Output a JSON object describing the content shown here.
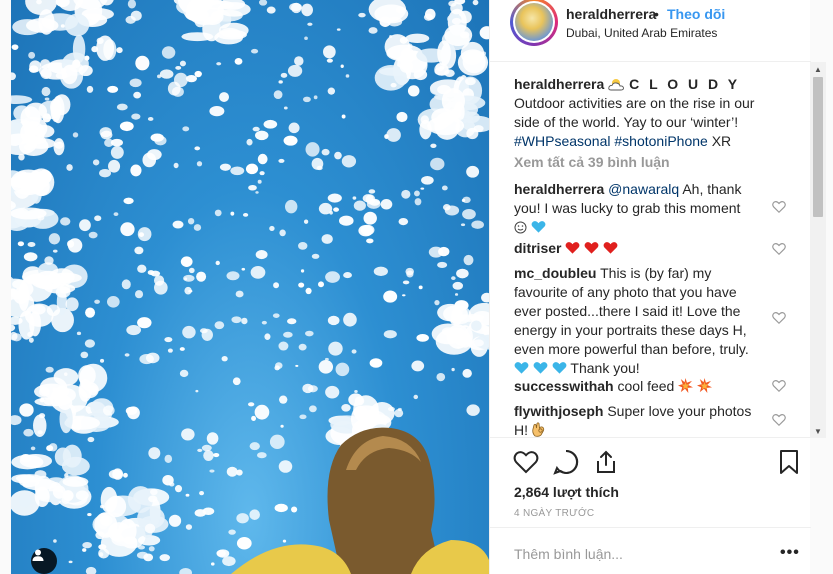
{
  "post": {
    "username": "heraldherrera",
    "follow_label": "Theo dõi",
    "location": "Dubai, United Arab Emirates"
  },
  "caption": {
    "username": "heraldherrera",
    "title": "C L O U D Y",
    "text_line1": "Outdoor activities are on the rise in our",
    "text_line2": "side of the world. Yay to our ‘winter’!",
    "hashtag1": "#WHPseasonal",
    "hashtag2": "#shotoniPhone",
    "suffix": " XR"
  },
  "view_all_comments": "Xem tất cả 39 bình luận",
  "comments": [
    {
      "user": "heraldherrera",
      "mention": "@nawaralq",
      "text1": " Ah, thank",
      "text2": "you! I was lucky to grab this moment"
    },
    {
      "user": "ditriser",
      "text": ""
    },
    {
      "user": "mc_doubleu",
      "text1": " This is (by far) my",
      "text2": "favourite of any photo that you have",
      "text3": "ever posted...there I said it! Love the",
      "text4": "energy in your portraits these days H,",
      "text5": "even more powerful than before, truly.",
      "text6": " Thank you!"
    },
    {
      "user": "successwithah",
      "text": " cool feed "
    },
    {
      "user": "flywithjoseph",
      "text1": " Super love your photos",
      "text2": "H! "
    }
  ],
  "likes": "2,864 lượt thích",
  "time_ago": "4 NGÀY TRƯỚC",
  "add_comment_placeholder": "Thêm bình luận...",
  "more_options": "•••",
  "icons": [
    "heart-icon",
    "comment-icon",
    "share-icon",
    "bookmark-icon",
    "user-tag-icon",
    "cloud-emoji",
    "heart-emoji",
    "blue-heart-emoji",
    "explosion-emoji",
    "ok-hand-emoji"
  ],
  "colors": {
    "link": "#3897f0",
    "hashtag": "#003569",
    "muted": "#999999",
    "text": "#262626",
    "sky": "#2d8fd2"
  }
}
